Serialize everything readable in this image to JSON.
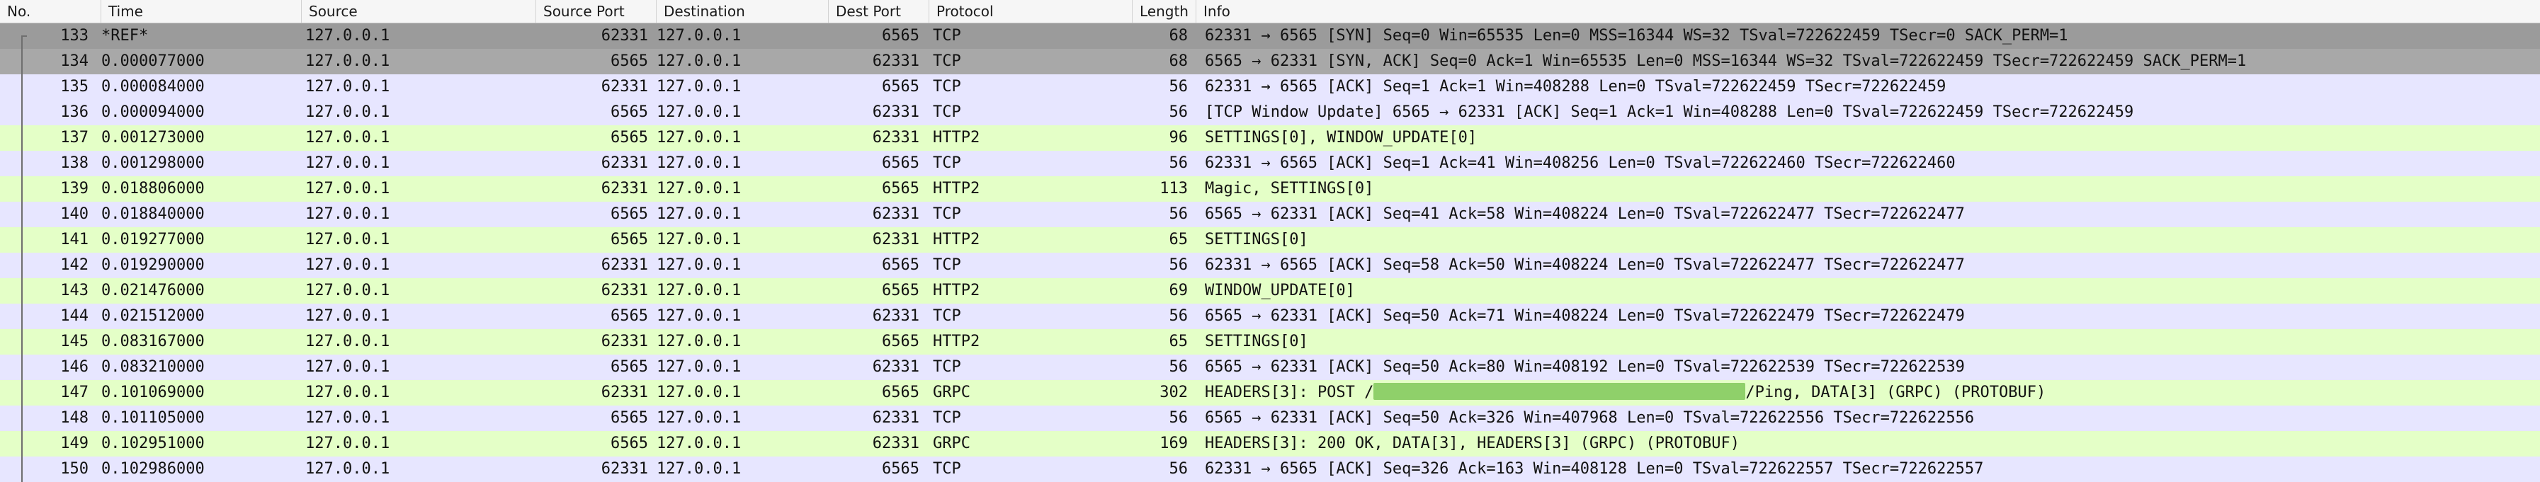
{
  "columns": {
    "no": "No.",
    "time": "Time",
    "source": "Source",
    "source_port": "Source Port",
    "destination": "Destination",
    "dest_port": "Dest Port",
    "protocol": "Protocol",
    "length": "Length",
    "info": "Info"
  },
  "colors": {
    "tcp": "#e7e6ff",
    "http2": "#e4ffc7",
    "selected": "#9b9b9b",
    "redaction": "#8fd06a"
  },
  "packets": [
    {
      "no": "133",
      "time": "*REF*",
      "source": "127.0.0.1",
      "source_port": "62331",
      "destination": "127.0.0.1",
      "dest_port": "6565",
      "protocol": "TCP",
      "length": "68",
      "info": "62331 → 6565 [SYN] Seq=0 Win=65535 Len=0 MSS=16344 WS=32 TSval=722622459 TSecr=0 SACK_PERM=1",
      "style": "selected",
      "info_parts": null
    },
    {
      "no": "134",
      "time": "0.000077000",
      "source": "127.0.0.1",
      "source_port": "6565",
      "destination": "127.0.0.1",
      "dest_port": "62331",
      "protocol": "TCP",
      "length": "68",
      "info": "6565 → 62331 [SYN, ACK] Seq=0 Ack=1 Win=65535 Len=0 MSS=16344 WS=32 TSval=722622459 TSecr=722622459 SACK_PERM=1",
      "style": "related",
      "info_parts": null
    },
    {
      "no": "135",
      "time": "0.000084000",
      "source": "127.0.0.1",
      "source_port": "62331",
      "destination": "127.0.0.1",
      "dest_port": "6565",
      "protocol": "TCP",
      "length": "56",
      "info": "62331 → 6565 [ACK] Seq=1 Ack=1 Win=408288 Len=0 TSval=722622459 TSecr=722622459",
      "style": "tcp",
      "info_parts": null
    },
    {
      "no": "136",
      "time": "0.000094000",
      "source": "127.0.0.1",
      "source_port": "6565",
      "destination": "127.0.0.1",
      "dest_port": "62331",
      "protocol": "TCP",
      "length": "56",
      "info": "[TCP Window Update] 6565 → 62331 [ACK] Seq=1 Ack=1 Win=408288 Len=0 TSval=722622459 TSecr=722622459",
      "style": "tcp",
      "info_parts": null
    },
    {
      "no": "137",
      "time": "0.001273000",
      "source": "127.0.0.1",
      "source_port": "6565",
      "destination": "127.0.0.1",
      "dest_port": "62331",
      "protocol": "HTTP2",
      "length": "96",
      "info": "SETTINGS[0], WINDOW_UPDATE[0]",
      "style": "http2",
      "info_parts": null
    },
    {
      "no": "138",
      "time": "0.001298000",
      "source": "127.0.0.1",
      "source_port": "62331",
      "destination": "127.0.0.1",
      "dest_port": "6565",
      "protocol": "TCP",
      "length": "56",
      "info": "62331 → 6565 [ACK] Seq=1 Ack=41 Win=408256 Len=0 TSval=722622460 TSecr=722622460",
      "style": "tcp",
      "info_parts": null
    },
    {
      "no": "139",
      "time": "0.018806000",
      "source": "127.0.0.1",
      "source_port": "62331",
      "destination": "127.0.0.1",
      "dest_port": "6565",
      "protocol": "HTTP2",
      "length": "113",
      "info": "Magic, SETTINGS[0]",
      "style": "http2",
      "info_parts": null
    },
    {
      "no": "140",
      "time": "0.018840000",
      "source": "127.0.0.1",
      "source_port": "6565",
      "destination": "127.0.0.1",
      "dest_port": "62331",
      "protocol": "TCP",
      "length": "56",
      "info": "6565 → 62331 [ACK] Seq=41 Ack=58 Win=408224 Len=0 TSval=722622477 TSecr=722622477",
      "style": "tcp",
      "info_parts": null
    },
    {
      "no": "141",
      "time": "0.019277000",
      "source": "127.0.0.1",
      "source_port": "6565",
      "destination": "127.0.0.1",
      "dest_port": "62331",
      "protocol": "HTTP2",
      "length": "65",
      "info": "SETTINGS[0]",
      "style": "http2",
      "info_parts": null
    },
    {
      "no": "142",
      "time": "0.019290000",
      "source": "127.0.0.1",
      "source_port": "62331",
      "destination": "127.0.0.1",
      "dest_port": "6565",
      "protocol": "TCP",
      "length": "56",
      "info": "62331 → 6565 [ACK] Seq=58 Ack=50 Win=408224 Len=0 TSval=722622477 TSecr=722622477",
      "style": "tcp",
      "info_parts": null
    },
    {
      "no": "143",
      "time": "0.021476000",
      "source": "127.0.0.1",
      "source_port": "62331",
      "destination": "127.0.0.1",
      "dest_port": "6565",
      "protocol": "HTTP2",
      "length": "69",
      "info": "WINDOW_UPDATE[0]",
      "style": "http2",
      "info_parts": null
    },
    {
      "no": "144",
      "time": "0.021512000",
      "source": "127.0.0.1",
      "source_port": "6565",
      "destination": "127.0.0.1",
      "dest_port": "62331",
      "protocol": "TCP",
      "length": "56",
      "info": "6565 → 62331 [ACK] Seq=50 Ack=71 Win=408224 Len=0 TSval=722622479 TSecr=722622479",
      "style": "tcp",
      "info_parts": null
    },
    {
      "no": "145",
      "time": "0.083167000",
      "source": "127.0.0.1",
      "source_port": "62331",
      "destination": "127.0.0.1",
      "dest_port": "6565",
      "protocol": "HTTP2",
      "length": "65",
      "info": "SETTINGS[0]",
      "style": "http2",
      "info_parts": null
    },
    {
      "no": "146",
      "time": "0.083210000",
      "source": "127.0.0.1",
      "source_port": "6565",
      "destination": "127.0.0.1",
      "dest_port": "62331",
      "protocol": "TCP",
      "length": "56",
      "info": "6565 → 62331 [ACK] Seq=50 Ack=80 Win=408192 Len=0 TSval=722622539 TSecr=722622539",
      "style": "tcp",
      "info_parts": null
    },
    {
      "no": "147",
      "time": "0.101069000",
      "source": "127.0.0.1",
      "source_port": "62331",
      "destination": "127.0.0.1",
      "dest_port": "6565",
      "protocol": "GRPC",
      "length": "302",
      "info": "",
      "style": "http2",
      "info_parts": {
        "before": "HEADERS[3]: POST /",
        "after": "/Ping, DATA[3] (GRPC) (PROTOBUF)"
      }
    },
    {
      "no": "148",
      "time": "0.101105000",
      "source": "127.0.0.1",
      "source_port": "6565",
      "destination": "127.0.0.1",
      "dest_port": "62331",
      "protocol": "TCP",
      "length": "56",
      "info": "6565 → 62331 [ACK] Seq=50 Ack=326 Win=407968 Len=0 TSval=722622556 TSecr=722622556",
      "style": "tcp",
      "info_parts": null
    },
    {
      "no": "149",
      "time": "0.102951000",
      "source": "127.0.0.1",
      "source_port": "6565",
      "destination": "127.0.0.1",
      "dest_port": "62331",
      "protocol": "GRPC",
      "length": "169",
      "info": "HEADERS[3]: 200 OK, DATA[3], HEADERS[3] (GRPC) (PROTOBUF)",
      "style": "http2",
      "info_parts": null
    },
    {
      "no": "150",
      "time": "0.102986000",
      "source": "127.0.0.1",
      "source_port": "62331",
      "destination": "127.0.0.1",
      "dest_port": "6565",
      "protocol": "TCP",
      "length": "56",
      "info": "62331 → 6565 [ACK] Seq=326 Ack=163 Win=408128 Len=0 TSval=722622557 TSecr=722622557",
      "style": "tcp",
      "info_parts": null
    }
  ]
}
